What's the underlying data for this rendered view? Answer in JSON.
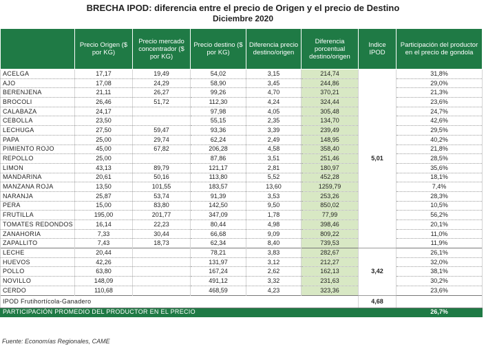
{
  "title": "BRECHA IPOD: diferencia entre el precio de Origen y el precio de Destino",
  "subtitle": "Diciembre 2020",
  "headers": {
    "origen": "Precio Origen ($ por KG)",
    "mercado": "Precio mercado concentrador ($ por KG)",
    "destino": "Precio destino ($ por KG)",
    "diferencia": "Diferencia precio destino/origen",
    "porcentual": "Diferencia porcentual destino/origen",
    "ipod": "Indice IPOD",
    "participacion": "Participación del productor en el precio de gondola"
  },
  "group1_ipod": "5,01",
  "group2_ipod": "3,42",
  "rows": [
    {
      "name": "ACELGA",
      "origen": "17,17",
      "mercado": "19,49",
      "destino": "54,02",
      "dif": "3,15",
      "pct": "214,74",
      "part": "31,8%"
    },
    {
      "name": "AJO",
      "origen": "17,08",
      "mercado": "24,29",
      "destino": "58,90",
      "dif": "3,45",
      "pct": "244,86",
      "part": "29,0%"
    },
    {
      "name": "BERENJENA",
      "origen": "21,11",
      "mercado": "26,27",
      "destino": "99,26",
      "dif": "4,70",
      "pct": "370,21",
      "part": "21,3%"
    },
    {
      "name": "BROCOLI",
      "origen": "26,46",
      "mercado": "51,72",
      "destino": "112,30",
      "dif": "4,24",
      "pct": "324,44",
      "part": "23,6%"
    },
    {
      "name": "CALABAZA",
      "origen": "24,17",
      "mercado": "",
      "destino": "97,98",
      "dif": "4,05",
      "pct": "305,48",
      "part": "24,7%"
    },
    {
      "name": "CEBOLLA",
      "origen": "23,50",
      "mercado": "",
      "destino": "55,15",
      "dif": "2,35",
      "pct": "134,70",
      "part": "42,6%"
    },
    {
      "name": "LECHUGA",
      "origen": "27,50",
      "mercado": "59,47",
      "destino": "93,36",
      "dif": "3,39",
      "pct": "239,49",
      "part": "29,5%"
    },
    {
      "name": "PAPA",
      "origen": "25,00",
      "mercado": "29,74",
      "destino": "62,24",
      "dif": "2,49",
      "pct": "148,95",
      "part": "40,2%"
    },
    {
      "name": "PIMIENTO ROJO",
      "origen": "45,00",
      "mercado": "67,82",
      "destino": "206,28",
      "dif": "4,58",
      "pct": "358,40",
      "part": "21,8%"
    },
    {
      "name": "REPOLLO",
      "origen": "25,00",
      "mercado": "",
      "destino": "87,86",
      "dif": "3,51",
      "pct": "251,46",
      "part": "28,5%"
    },
    {
      "name": "LIMON",
      "origen": "43,13",
      "mercado": "89,79",
      "destino": "121,17",
      "dif": "2,81",
      "pct": "180,97",
      "part": "35,6%"
    },
    {
      "name": "MANDARINA",
      "origen": "20,61",
      "mercado": "50,16",
      "destino": "113,80",
      "dif": "5,52",
      "pct": "452,28",
      "part": "18,1%"
    },
    {
      "name": "MANZANA ROJA",
      "origen": "13,50",
      "mercado": "101,55",
      "destino": "183,57",
      "dif": "13,60",
      "pct": "1259,79",
      "part": "7,4%"
    },
    {
      "name": "NARANJA",
      "origen": "25,87",
      "mercado": "53,74",
      "destino": "91,39",
      "dif": "3,53",
      "pct": "253,26",
      "part": "28,3%"
    },
    {
      "name": "PERA",
      "origen": "15,00",
      "mercado": "83,80",
      "destino": "142,50",
      "dif": "9,50",
      "pct": "850,02",
      "part": "10,5%"
    },
    {
      "name": "FRUTILLA",
      "origen": "195,00",
      "mercado": "201,77",
      "destino": "347,09",
      "dif": "1,78",
      "pct": "77,99",
      "part": "56,2%"
    },
    {
      "name": "TOMATES REDONDOS",
      "origen": "16,14",
      "mercado": "22,23",
      "destino": "80,44",
      "dif": "4,98",
      "pct": "398,46",
      "part": "20,1%"
    },
    {
      "name": "ZANAHORIA",
      "origen": "7,33",
      "mercado": "30,44",
      "destino": "66,68",
      "dif": "9,09",
      "pct": "809,22",
      "part": "11,0%"
    },
    {
      "name": "ZAPALLITO",
      "origen": "7,43",
      "mercado": "18,73",
      "destino": "62,34",
      "dif": "8,40",
      "pct": "739,53",
      "part": "11,9%"
    },
    {
      "name": "LECHE",
      "origen": "20,44",
      "mercado": "",
      "destino": "78,21",
      "dif": "3,83",
      "pct": "282,67",
      "part": "26,1%"
    },
    {
      "name": "HUEVOS",
      "origen": "42,26",
      "mercado": "",
      "destino": "131,97",
      "dif": "3,12",
      "pct": "212,27",
      "part": "32,0%"
    },
    {
      "name": "POLLO",
      "origen": "63,80",
      "mercado": "",
      "destino": "167,24",
      "dif": "2,62",
      "pct": "162,13",
      "part": "38,1%"
    },
    {
      "name": "NOVILLO",
      "origen": "148,09",
      "mercado": "",
      "destino": "491,12",
      "dif": "3,32",
      "pct": "231,63",
      "part": "30,2%"
    },
    {
      "name": "CERDO",
      "origen": "110,68",
      "mercado": "",
      "destino": "468,59",
      "dif": "4,23",
      "pct": "323,36",
      "part": "23,6%"
    }
  ],
  "summary": {
    "label": "IPOD Frutihortícola-Ganadero",
    "value": "4,68"
  },
  "participation": {
    "label": "PARTICIPACIÓN PROMEDIO DEL PRODUCTOR EN EL PRECIO",
    "value": "26,7%"
  },
  "source": "Fuente: Economías Regionales, CAME",
  "colors": {
    "header_bg": "#1f7a45",
    "highlight_bg": "#d8e8c4"
  }
}
